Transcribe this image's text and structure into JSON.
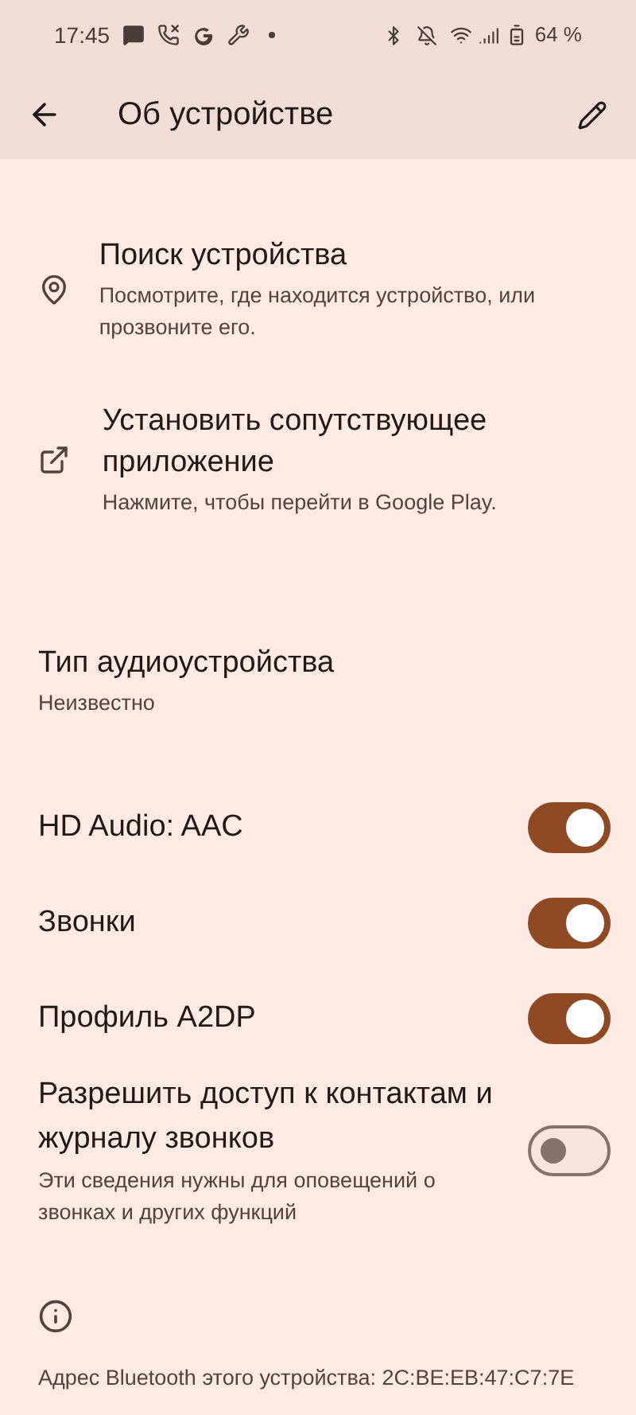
{
  "status_bar": {
    "time": "17:45",
    "battery": "64 %"
  },
  "app_bar": {
    "title": "Об устройстве"
  },
  "actions": [
    {
      "kind": "location",
      "title": "Поиск устройства",
      "subtitle": "Посмотрите, где находится устройство, или прозвоните его."
    },
    {
      "kind": "external",
      "title": "Установить сопутствующее приложение",
      "subtitle": "Нажмите, чтобы перейти в Google Play."
    }
  ],
  "audio_type": {
    "title": "Тип аудиоустройства",
    "value": "Неизвестно"
  },
  "toggles": [
    {
      "title": "HD Audio: AAC",
      "on": true
    },
    {
      "title": "Звонки",
      "on": true
    },
    {
      "title": "Профиль A2DP",
      "on": true
    },
    {
      "title": "Разрешить доступ к контактам и журналу звонков",
      "subtitle": "Эти сведения нужны для оповещений о звонках и других функций",
      "on": false
    }
  ],
  "footer": {
    "address": "Адрес Bluetooth этого устройства: 2C:BE:EB:47:C7:7E"
  }
}
